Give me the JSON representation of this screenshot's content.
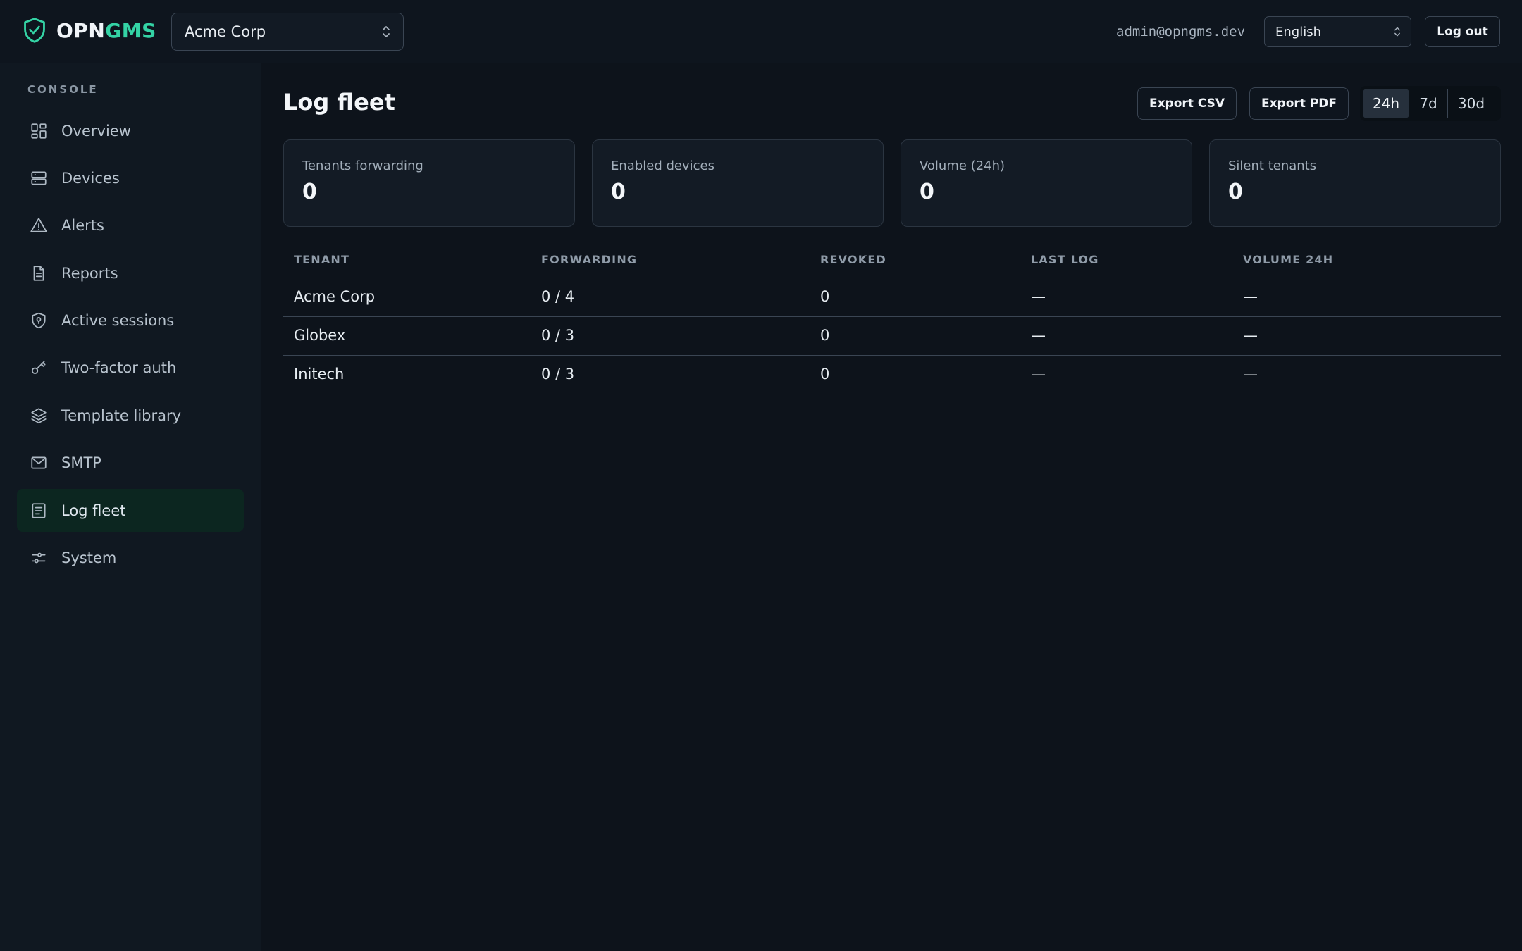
{
  "brand": {
    "name_part1": "OPN",
    "name_part2": "GMS",
    "accent": "#34d3a5"
  },
  "header": {
    "tenant_selected": "Acme Corp",
    "user_email": "admin@opngms.dev",
    "language_selected": "English",
    "logout_label": "Log out"
  },
  "sidebar": {
    "heading": "CONSOLE",
    "items": [
      {
        "label": "Overview",
        "icon": "dashboard-grid-icon"
      },
      {
        "label": "Devices",
        "icon": "server-icon"
      },
      {
        "label": "Alerts",
        "icon": "warning-triangle-icon"
      },
      {
        "label": "Reports",
        "icon": "document-icon"
      },
      {
        "label": "Active sessions",
        "icon": "shield-pin-icon"
      },
      {
        "label": "Two-factor auth",
        "icon": "key-icon"
      },
      {
        "label": "Template library",
        "icon": "layers-icon"
      },
      {
        "label": "SMTP",
        "icon": "mail-icon"
      },
      {
        "label": "Log fleet",
        "icon": "log-list-icon",
        "active": true
      },
      {
        "label": "System",
        "icon": "sliders-icon"
      }
    ]
  },
  "main": {
    "title": "Log fleet",
    "export_csv_label": "Export CSV",
    "export_pdf_label": "Export PDF",
    "ranges": [
      "24h",
      "7d",
      "30d"
    ],
    "range_selected": "24h",
    "stats": [
      {
        "label": "Tenants forwarding",
        "value": "0"
      },
      {
        "label": "Enabled devices",
        "value": "0"
      },
      {
        "label": "Volume (24h)",
        "value": "0"
      },
      {
        "label": "Silent tenants",
        "value": "0"
      }
    ],
    "table": {
      "columns": [
        "TENANT",
        "FORWARDING",
        "REVOKED",
        "LAST LOG",
        "VOLUME 24H"
      ],
      "rows": [
        [
          "Acme Corp",
          "0 / 4",
          "0",
          "—",
          "—"
        ],
        [
          "Globex",
          "0 / 3",
          "0",
          "—",
          "—"
        ],
        [
          "Initech",
          "0 / 3",
          "0",
          "—",
          "—"
        ]
      ]
    }
  }
}
